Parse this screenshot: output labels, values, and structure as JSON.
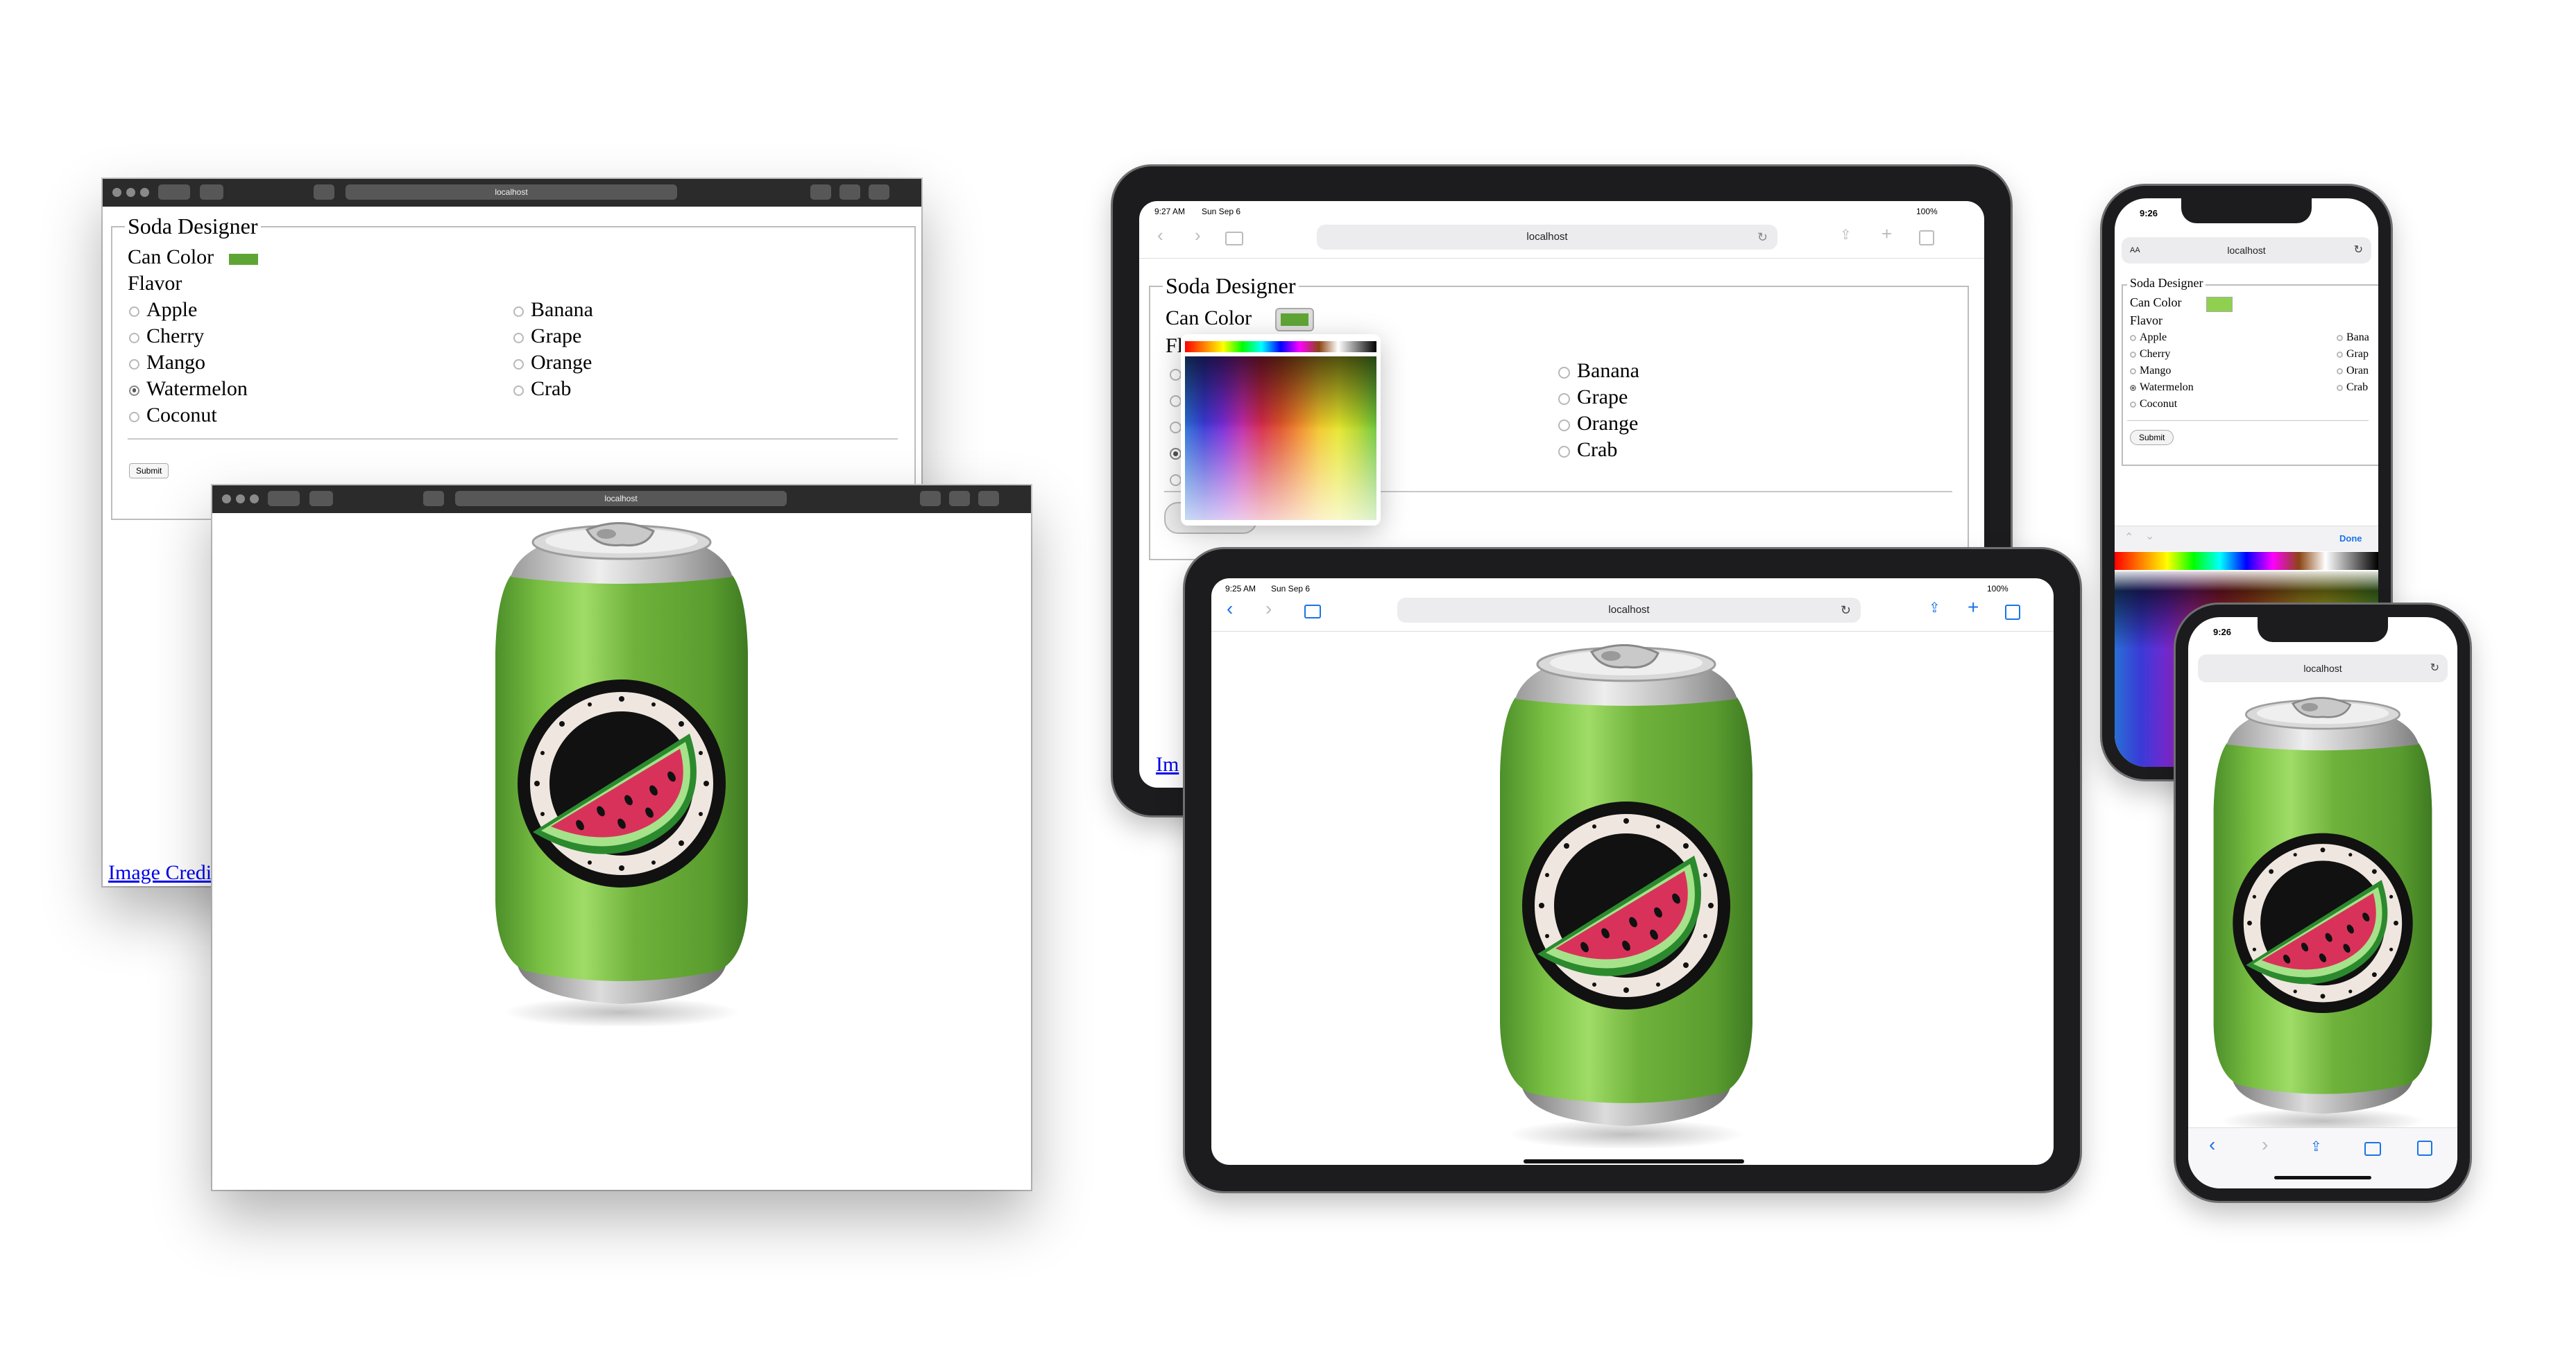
{
  "url": "localhost",
  "form": {
    "legend": "Soda Designer",
    "can_color_label": "Can Color",
    "flavor_label": "Flavor",
    "flavor_label_partial": "Fl",
    "submit": "Submit",
    "image_credit": "Image Credits",
    "image_credit_partial": "Im",
    "flavors_left": [
      "Apple",
      "Cherry",
      "Mango",
      "Watermelon",
      "Coconut"
    ],
    "flavors_right": [
      "Banana",
      "Grape",
      "Orange",
      "Crab"
    ],
    "flavors_right_truncated": [
      "Bana",
      "Grap",
      "Oran",
      "Crab"
    ],
    "selected_flavor": "Watermelon"
  },
  "colors": {
    "can_green": "#5fa535",
    "can_green_light": "#8fd14f",
    "mac_titlebar": "#2b2b2b",
    "link": "#0000ee",
    "ios_blue": "#1a73e8",
    "watermelon_pink": "#d8325b"
  },
  "ipad_back": {
    "time": "9:27 AM",
    "date": "Sun Sep 6",
    "battery": "100%"
  },
  "ipad_front": {
    "time": "9:25 AM",
    "date": "Sun Sep 6",
    "battery": "100%"
  },
  "iphone_back": {
    "time": "9:26",
    "text_size_label": "AA",
    "done": "Done"
  },
  "iphone_front": {
    "time": "9:26"
  },
  "icons": [
    "back-chevron-icon",
    "forward-chevron-icon",
    "bookmarks-icon",
    "share-icon",
    "plus-icon",
    "tabs-icon",
    "reload-icon",
    "wifi-icon",
    "battery-icon",
    "watermelon-logo"
  ]
}
